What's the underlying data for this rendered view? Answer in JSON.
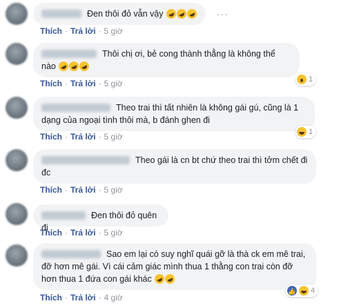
{
  "actions": {
    "like": "Thích",
    "reply": "Trả lời"
  },
  "more_icon": "···",
  "comments": [
    {
      "text": "Đen thôi đỏ vẫn vậy",
      "emojis": 3,
      "time": "5 giờ",
      "reaction": null
    },
    {
      "text": "Thôi chị ơi, bẻ cong thành thẳng là không thể nào",
      "emojis": 3,
      "time": "5 giờ",
      "reaction": {
        "icon": "wow",
        "count": "1"
      }
    },
    {
      "text": "Theo trai thì tất nhiên là không gái gú, cũng là 1 dạng của ngoại tình thôi mà, b đánh ghen đi",
      "emojis": 0,
      "time": "5 giờ",
      "reaction": {
        "icon": "haha",
        "count": "1"
      }
    },
    {
      "text": "Theo gái là cn bt chứ theo trai thì tởm chết đi đc",
      "emojis": 0,
      "time": "5 giờ",
      "reaction": null
    },
    {
      "text": "Đen thôi đỏ quên đi",
      "emojis": 0,
      "time": "5 giờ",
      "reaction": null
    },
    {
      "text": "Sao em lại có suy nghĩ quái gỡ là thà ck em mê trai, đỡ hơn mê gái. Vì cái cảm giác mình thua 1 thằng con trai còn đỡ hơn thua 1 đứa con gái khác",
      "emojis": 2,
      "time": "4 giờ",
      "reaction": {
        "icon": "like-haha",
        "count": "4"
      }
    }
  ]
}
